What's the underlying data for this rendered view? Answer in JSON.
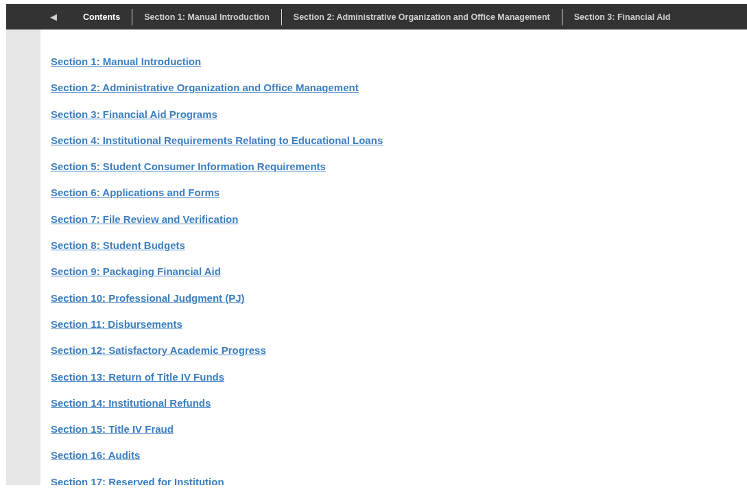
{
  "nav": {
    "back": "◀",
    "items": [
      {
        "label": "Contents",
        "selected": true
      },
      {
        "label": "Section 1: Manual Introduction",
        "selected": false
      },
      {
        "label": "Section 2: Administrative Organization and Office Management",
        "selected": false
      },
      {
        "label": "Section 3: Financial Aid",
        "selected": false
      }
    ]
  },
  "links": [
    "Section 1: Manual Introduction",
    "Section 2: Administrative Organization and Office Management",
    "Section 3: Financial Aid Programs",
    "Section 4: Institutional Requirements Relating to Educational Loans",
    "Section 5: Student Consumer Information Requirements",
    "Section 6: Applications and Forms",
    "Section 7: File Review and Verification",
    "Section 8: Student Budgets",
    "Section 9: Packaging Financial Aid",
    "Section 10: Professional Judgment (PJ)",
    "Section 11: Disbursements",
    "Section 12: Satisfactory Academic Progress",
    "Section 13: Return of Title IV Funds",
    "Section 14: Institutional Refunds",
    "Section 15: Title IV Fraud",
    "Section 16: Audits",
    "Section 17: Reserved for Institution"
  ]
}
